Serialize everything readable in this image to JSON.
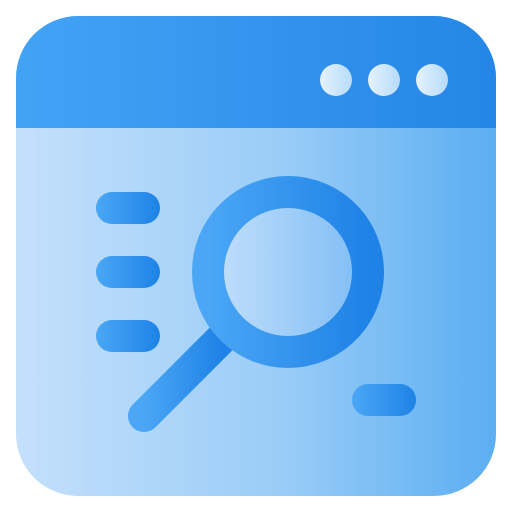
{
  "icon": {
    "name": "browser-search-icon",
    "colors": {
      "frame_dark": "#2486E6",
      "frame_light": "#42A3F5",
      "body_light": "#C4E0FB",
      "body_mid": "#8CC4F6",
      "body_dark": "#5BAEF2",
      "dot_light": "#E5F2FD",
      "dot_dark": "#B7DBFA",
      "accent_light": "#4BA6F5",
      "accent_dark": "#1E82E6"
    },
    "window_dots": 3,
    "text_lines": 3
  }
}
